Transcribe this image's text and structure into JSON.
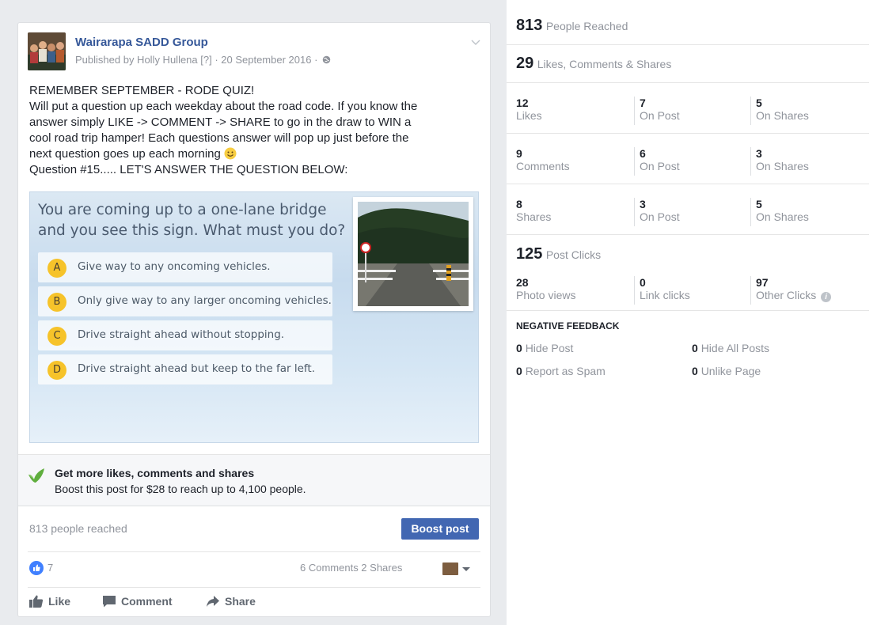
{
  "post": {
    "page_name": "Wairarapa SADD Group",
    "meta": "Published by Holly Hullena [?] · 20 September 2016 ·",
    "text_lines": [
      "REMEMBER SEPTEMBER - RODE QUIZ!",
      "Will put a question up each weekday about the road code. If you know the",
      "answer simply LIKE -> COMMENT -> SHARE to go in the draw to WIN a",
      "cool road trip hamper! Each questions answer will pop up just before the",
      "next question goes up each morning",
      "Question #15..... LET'S ANSWER THE QUESTION BELOW:"
    ],
    "quiz": {
      "question_line1": "You are coming up to a one-lane bridge",
      "question_line2": "and you see this sign. What must you do?",
      "options": [
        {
          "letter": "A",
          "text": "Give way to any oncoming vehicles."
        },
        {
          "letter": "B",
          "text": "Only give way to any larger oncoming vehicles."
        },
        {
          "letter": "C",
          "text": "Drive straight ahead without stopping."
        },
        {
          "letter": "D",
          "text": "Drive straight ahead but keep to the far left."
        }
      ]
    },
    "promo": {
      "title": "Get more likes, comments and shares",
      "subtitle": "Boost this post for $28 to reach up to 4,100 people."
    },
    "reach_text": "813 people reached",
    "boost_label": "Boost post",
    "like_count": "7",
    "comments_shares": "6 Comments  2 Shares",
    "actions": {
      "like": "Like",
      "comment": "Comment",
      "share": "Share"
    },
    "colors": {
      "link": "#365899",
      "button": "#4267b2",
      "like_blue": "#4080ff",
      "badge_yellow": "#f6c32a"
    }
  },
  "insights": {
    "people_reached": {
      "value": "813",
      "label": "People Reached"
    },
    "engagement": {
      "value": "29",
      "label": "Likes, Comments & Shares"
    },
    "likes_row": [
      {
        "value": "12",
        "label": "Likes"
      },
      {
        "value": "7",
        "label": "On Post"
      },
      {
        "value": "5",
        "label": "On Shares"
      }
    ],
    "comments_row": [
      {
        "value": "9",
        "label": "Comments"
      },
      {
        "value": "6",
        "label": "On Post"
      },
      {
        "value": "3",
        "label": "On Shares"
      }
    ],
    "shares_row": [
      {
        "value": "8",
        "label": "Shares"
      },
      {
        "value": "3",
        "label": "On Post"
      },
      {
        "value": "5",
        "label": "On Shares"
      }
    ],
    "post_clicks": {
      "value": "125",
      "label": "Post Clicks"
    },
    "clicks_row": [
      {
        "value": "28",
        "label": "Photo views"
      },
      {
        "value": "0",
        "label": "Link clicks"
      },
      {
        "value": "97",
        "label": "Other Clicks"
      }
    ],
    "negative_feedback": {
      "title": "NEGATIVE FEEDBACK",
      "items": [
        {
          "value": "0",
          "label": "Hide Post"
        },
        {
          "value": "0",
          "label": "Hide All Posts"
        },
        {
          "value": "0",
          "label": "Report as Spam"
        },
        {
          "value": "0",
          "label": "Unlike Page"
        }
      ]
    }
  }
}
